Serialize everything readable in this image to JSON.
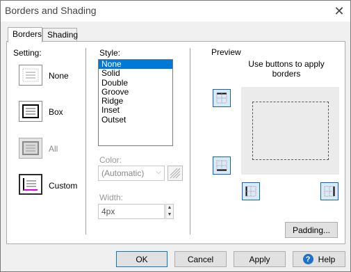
{
  "window": {
    "title": "Borders and Shading",
    "close_glyph": "✕"
  },
  "tabs": [
    {
      "label": "Borders",
      "active": true
    },
    {
      "label": "Shading",
      "active": false
    }
  ],
  "setting": {
    "label": "Setting:",
    "options": [
      {
        "label": "None",
        "enabled": true,
        "selected": false
      },
      {
        "label": "Box",
        "enabled": true,
        "selected": false
      },
      {
        "label": "All",
        "enabled": false,
        "selected": false
      },
      {
        "label": "Custom",
        "enabled": true,
        "selected": true
      }
    ]
  },
  "style": {
    "label": "Style:",
    "items": [
      "None",
      "Solid",
      "Double",
      "Groove",
      "Ridge",
      "Inset",
      "Outset"
    ],
    "selected": "None"
  },
  "color": {
    "label": "Color:",
    "value": "(Automatic)",
    "dropdown_glyph": "⌵"
  },
  "width": {
    "label": "Width:",
    "value": "4px",
    "up_glyph": "▲",
    "down_glyph": "▼"
  },
  "preview": {
    "label": "Preview",
    "hint": "Use buttons to apply borders"
  },
  "buttons": {
    "padding": "Padding...",
    "ok": "OK",
    "cancel": "Cancel",
    "apply": "Apply",
    "help": "Help",
    "help_glyph": "?"
  },
  "colors": {
    "selection": "#0078d7",
    "preview_button_border": "#0a65c8",
    "preview_button_fill": "#dbe9f8",
    "custom_accent": "#e000e0"
  }
}
